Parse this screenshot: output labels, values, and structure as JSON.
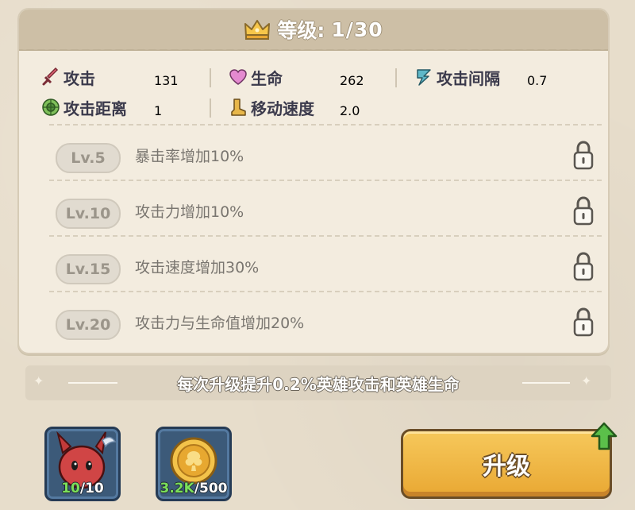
{
  "header": {
    "level_label": "等级:",
    "level_value": "1/30"
  },
  "stats": [
    {
      "icon": "sword-icon",
      "label": "攻击",
      "value": "131"
    },
    {
      "icon": "heart-icon",
      "label": "生命",
      "value": "262"
    },
    {
      "icon": "lightning-icon",
      "label": "攻击间隔",
      "value": "0.7"
    },
    {
      "icon": "range-target-icon",
      "label": "攻击距离",
      "value": "1"
    },
    {
      "icon": "boot-icon",
      "label": "移动速度",
      "value": "2.0"
    }
  ],
  "skills": [
    {
      "level": "Lv.5",
      "text": "暴击率增加10%"
    },
    {
      "level": "Lv.10",
      "text": "攻击力增加10%"
    },
    {
      "level": "Lv.15",
      "text": "攻击速度增加30%"
    },
    {
      "level": "Lv.20",
      "text": "攻击力与生命值增加20%"
    }
  ],
  "ribbon": {
    "text": "每次升级提升0.2%英雄攻击和英雄生命"
  },
  "items": [
    {
      "icon": "hero-shard-icon",
      "have": "10",
      "need": "/10"
    },
    {
      "icon": "gold-coin-icon",
      "have": "3.2K",
      "need": "/500"
    }
  ],
  "upgrade_button": {
    "label": "升级"
  },
  "colors": {
    "panel_bg": "#f3ecdf",
    "header_bg": "#cdbfa6",
    "button_gold": "#f2bb4a",
    "have_green": "#7be05a"
  }
}
